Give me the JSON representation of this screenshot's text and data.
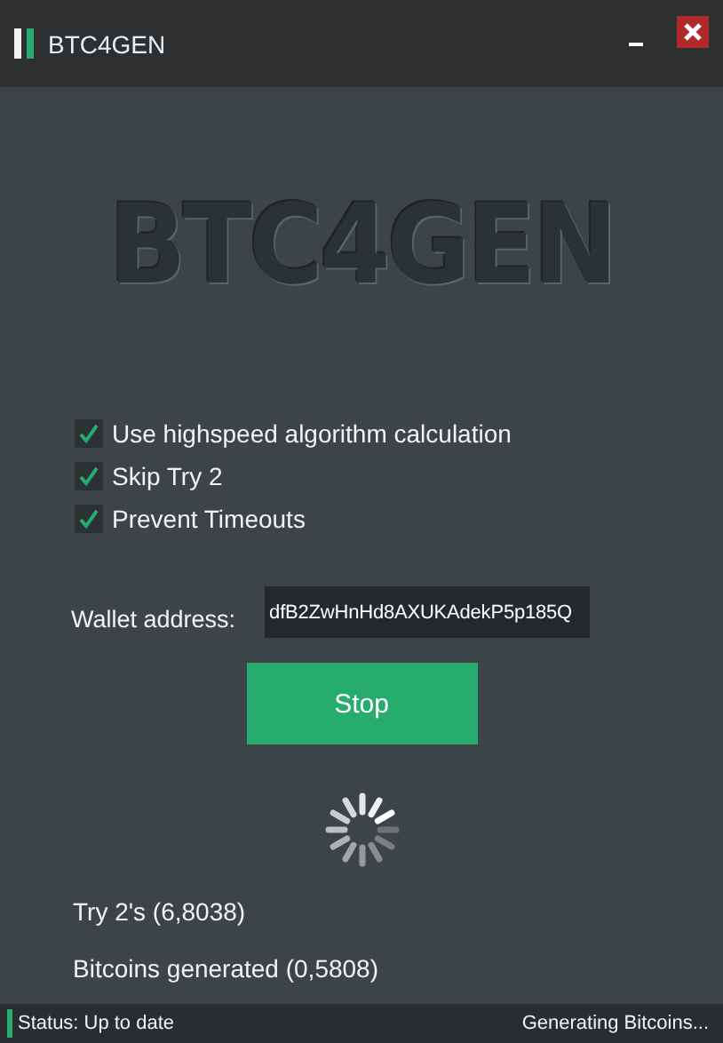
{
  "window": {
    "title": "BTC4GEN"
  },
  "logo": "BTC4GEN",
  "options": [
    {
      "label": "Use highspeed algorithm calculation",
      "checked": true
    },
    {
      "label": "Skip Try 2",
      "checked": true
    },
    {
      "label": "Prevent Timeouts",
      "checked": true
    }
  ],
  "wallet": {
    "label": "Wallet address:",
    "value": "dfB2ZwHnHd8AXUKAdekP5p185Q"
  },
  "button": "Stop",
  "stats": [
    "Try 2's (6,8038)",
    "Bitcoins generated (0,5808)"
  ],
  "status_bar": {
    "status_label": "Status:",
    "status": "Up to date",
    "activity": "Generating Bitcoins..."
  }
}
